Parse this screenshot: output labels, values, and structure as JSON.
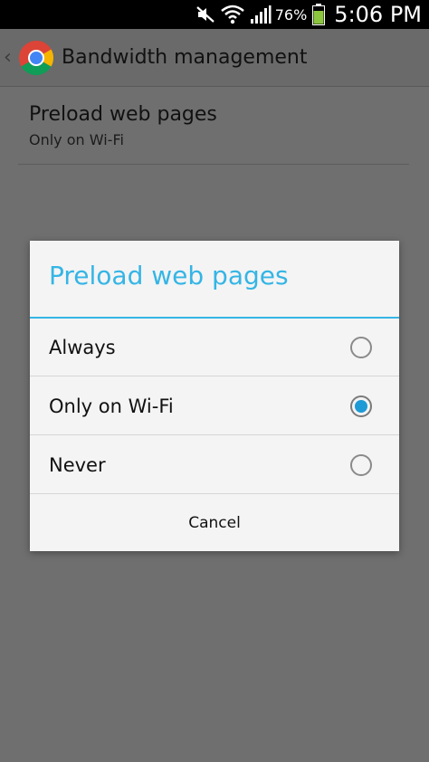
{
  "status_bar": {
    "icons": [
      "mute-icon",
      "wifi-icon",
      "signal-icon",
      "battery-icon"
    ],
    "battery_percent": "76%",
    "time": "5:06 PM"
  },
  "action_bar": {
    "title": "Bandwidth management",
    "logo": "chrome-logo"
  },
  "preference": {
    "title": "Preload web pages",
    "summary": "Only on Wi-Fi"
  },
  "dialog": {
    "title": "Preload web pages",
    "accent_color": "#35b5e5",
    "options": [
      {
        "label": "Always",
        "selected": false
      },
      {
        "label": "Only on Wi-Fi",
        "selected": true
      },
      {
        "label": "Never",
        "selected": false
      }
    ],
    "cancel_label": "Cancel"
  }
}
